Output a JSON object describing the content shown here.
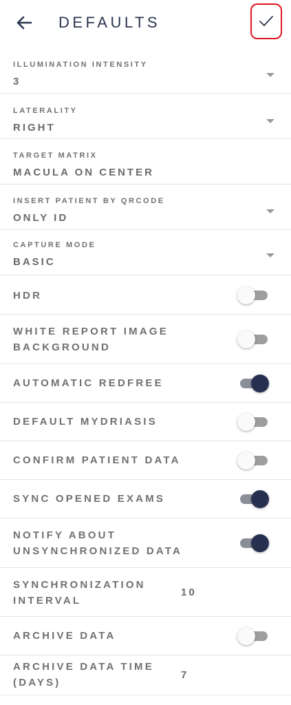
{
  "header": {
    "title": "DEFAULTS",
    "back_icon": "arrow-left-icon",
    "confirm_icon": "check-icon",
    "confirm_highlight": "#e0141c"
  },
  "selects": [
    {
      "label": "ILLUMINATION INTENSITY",
      "value": "3"
    },
    {
      "label": "LATERALITY",
      "value": "RIGHT"
    },
    {
      "label": "TARGET MATRIX",
      "value": "MACULA ON CENTER"
    },
    {
      "label": "INSERT PATIENT BY QRCODE",
      "value": "ONLY ID"
    },
    {
      "label": "CAPTURE MODE",
      "value": "BASIC"
    }
  ],
  "toggles": [
    {
      "label": "HDR",
      "on": false
    },
    {
      "label_lines": [
        "WHITE REPORT IMAGE",
        "BACKGROUND"
      ],
      "on": false
    },
    {
      "label": "AUTOMATIC REDFREE",
      "on": true
    },
    {
      "label": "DEFAULT MYDRIASIS",
      "on": false
    },
    {
      "label": "CONFIRM PATIENT DATA",
      "on": false
    },
    {
      "label": "SYNC OPENED EXAMS",
      "on": true
    },
    {
      "label_lines": [
        "NOTIFY ABOUT",
        "UNSYNCHRONIZED DATA"
      ],
      "on": true
    }
  ],
  "sync_interval": {
    "label_lines": [
      "SYNCHRONIZATION",
      "INTERVAL"
    ],
    "value": "10"
  },
  "archive": {
    "label": "ARCHIVE DATA",
    "on": false
  },
  "archive_time": {
    "label_lines": [
      "ARCHIVE DATA TIME",
      "(DAYS)"
    ],
    "value": "7"
  },
  "colors": {
    "accent": "#27304f",
    "toggle_off_track": "#9e9e9e",
    "toggle_on_track": "#8a8e98"
  }
}
